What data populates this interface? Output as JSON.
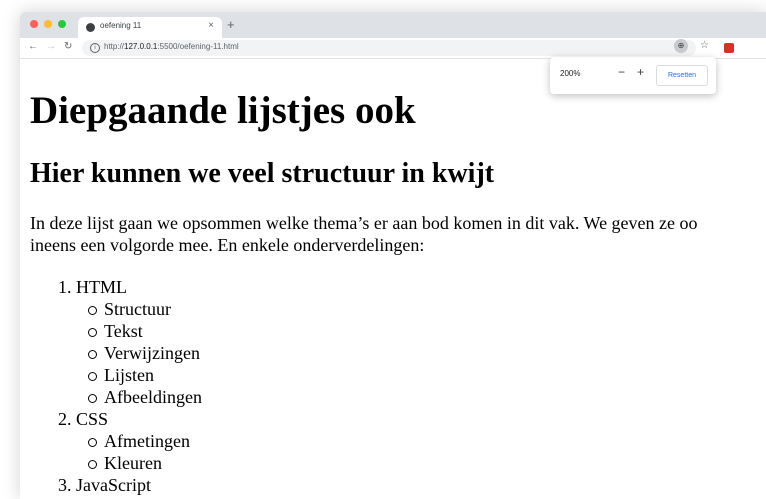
{
  "browser": {
    "tab_title": "oefening 11",
    "new_tab": "+",
    "tab_close": "×",
    "url_prefix": "http://",
    "url_host": "127.0.0.1",
    "url_rest": ":5500/oefening-11.html",
    "zoom_level": "200%",
    "zoom_minus": "−",
    "zoom_plus": "+",
    "reset_label": "Resetten",
    "colors": {
      "close": "#ff5f57",
      "minimize": "#febc2e",
      "maximize": "#28c840"
    }
  },
  "page": {
    "h1": "Diepgaande lijstjes ook",
    "h2": "Hier kunnen we veel structuur in kwijt",
    "paragraph_line1": "In deze lijst gaan we opsommen welke thema’s er aan bod komen in dit vak. We geven ze oo",
    "paragraph_line2": "ineens een volgorde mee. En enkele onderverdelingen:",
    "list": [
      {
        "num": "1.",
        "label": "HTML",
        "children": [
          "Structuur",
          "Tekst",
          "Verwijzingen",
          "Lijsten",
          "Afbeeldingen"
        ]
      },
      {
        "num": "2.",
        "label": "CSS",
        "children": [
          "Afmetingen",
          "Kleuren"
        ]
      },
      {
        "num": "3.",
        "label": "JavaScript",
        "children": []
      }
    ]
  }
}
